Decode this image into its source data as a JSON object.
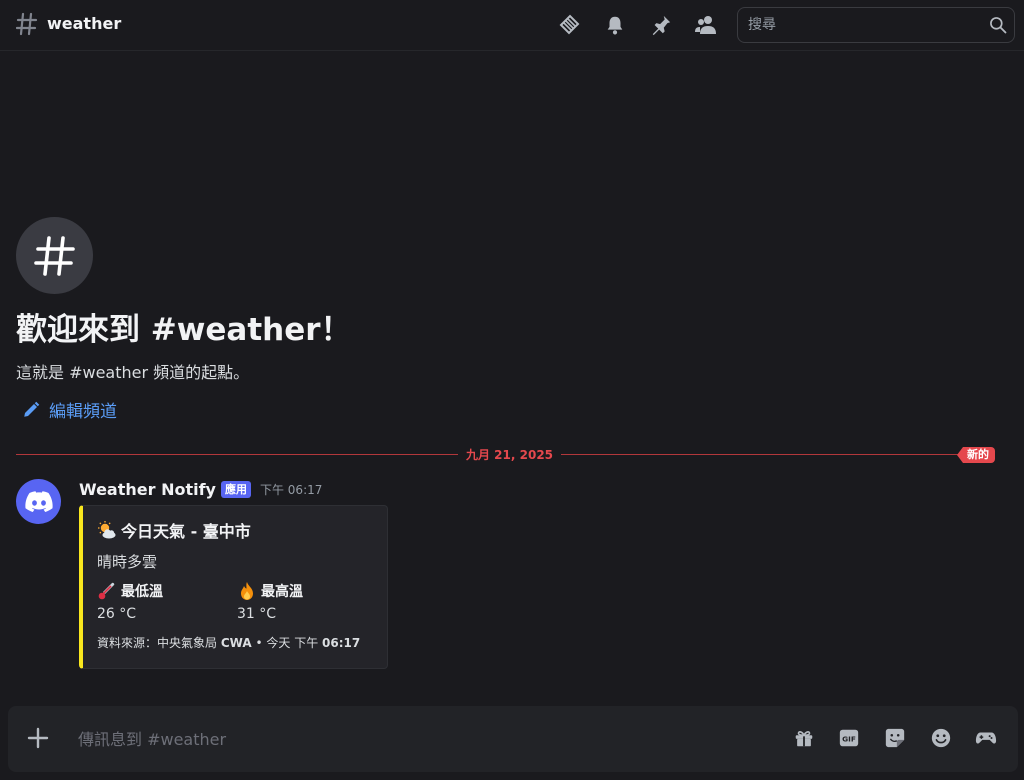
{
  "header": {
    "channel_name": "weather",
    "search_placeholder": "搜尋",
    "icons": [
      "threads-icon",
      "bell-icon",
      "pin-icon",
      "members-icon",
      "search-icon"
    ]
  },
  "welcome": {
    "title": "歡迎來到 #weather！",
    "subtitle": "這就是 #weather 頻道的起點。",
    "edit_link": "編輯頻道"
  },
  "divider": {
    "date": "九月 21, 2025",
    "new_label": "新的"
  },
  "message": {
    "author": "Weather Notify",
    "badge": "應用",
    "timestamp": "下午 06:17",
    "embed": {
      "accent_color": "#f9e71e",
      "title_icon": "sun-behind-cloud-icon",
      "title": "今日天氣 - 臺中市",
      "description": "晴時多雲",
      "fields": [
        {
          "icon": "thermometer-icon",
          "name": "最低溫",
          "value": "26 °C"
        },
        {
          "icon": "fire-icon",
          "name": "最高溫",
          "value": "31 °C"
        }
      ],
      "footer_source": "資料來源：中央氣象局",
      "footer_cwa": "CWA",
      "footer_sep": "•",
      "footer_time_prefix": "今天 下午",
      "footer_time": "06:17"
    }
  },
  "composer": {
    "placeholder": "傳訊息到 #weather",
    "icons": [
      "plus-icon",
      "gift-icon",
      "gif-icon",
      "sticker-icon",
      "emoji-icon",
      "activities-icon"
    ]
  },
  "colors": {
    "background": "#1a1a1e",
    "brand": "#5865f2",
    "new_red": "#e5484d",
    "link_blue": "#5a9cf5"
  }
}
